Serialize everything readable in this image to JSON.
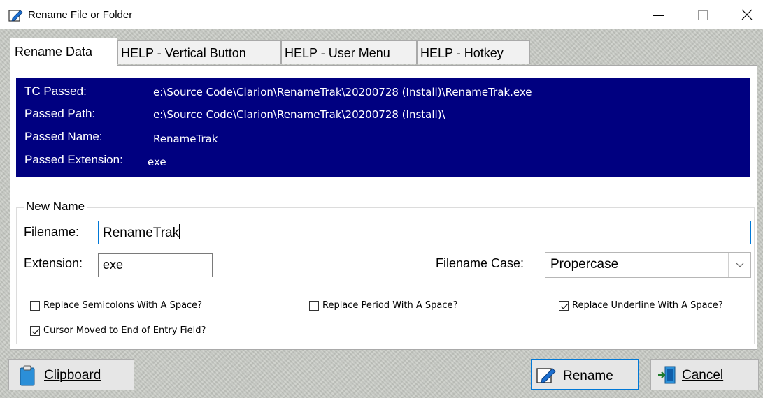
{
  "window": {
    "title": "Rename File or Folder",
    "icon": "rename-pencil-icon"
  },
  "tabs": [
    {
      "label": "Rename Data",
      "selected": true
    },
    {
      "label": "HELP - Vertical Button",
      "selected": false
    },
    {
      "label": "HELP - User Menu",
      "selected": false
    },
    {
      "label": "HELP - Hotkey",
      "selected": false
    }
  ],
  "info": {
    "tc_passed_label": "TC Passed:",
    "tc_passed_value": "e:\\Source Code\\Clarion\\RenameTrak\\20200728 (Install)\\RenameTrak.exe",
    "passed_path_label": "Passed Path:",
    "passed_path_value": "e:\\Source Code\\Clarion\\RenameTrak\\20200728 (Install)\\",
    "passed_name_label": "Passed Name:",
    "passed_name_value": "RenameTrak",
    "passed_ext_label": "Passed Extension:",
    "passed_ext_value": "exe",
    "background": "#000080"
  },
  "new_name": {
    "legend": "New Name",
    "filename_label": "Filename:",
    "filename_value": "RenameTrak",
    "extension_label": "Extension:",
    "extension_value": "exe",
    "case_label": "Filename Case:",
    "case_value": "Propercase"
  },
  "options": {
    "semicolon": {
      "label": "Replace Semicolons With A Space?",
      "checked": false
    },
    "period": {
      "label": "Replace Period With A Space?",
      "checked": false
    },
    "underline": {
      "label": "Replace Underline With A Space?",
      "checked": true
    },
    "cursor": {
      "label": "Cursor Moved to End of Entry Field?",
      "checked": true
    }
  },
  "buttons": {
    "clipboard_label": "Clipboard",
    "rename_label": "Rename",
    "cancel_label": "Cancel"
  },
  "colors": {
    "accent": "#0078d7",
    "info_bg": "#000080"
  }
}
